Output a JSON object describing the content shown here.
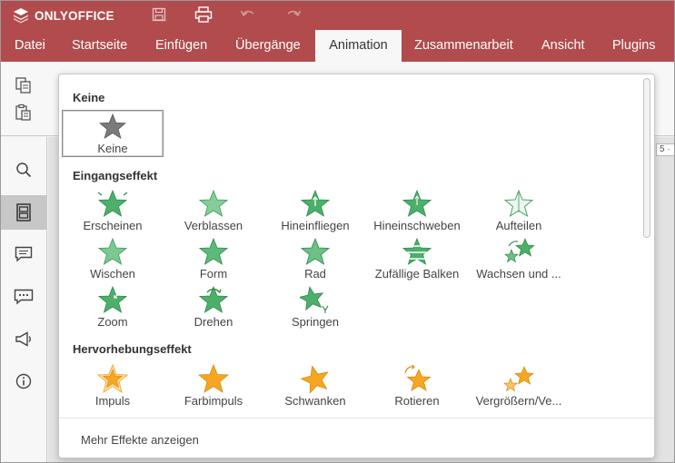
{
  "app": {
    "logo_text": "ONLYOFFICE"
  },
  "quick_access": [
    {
      "name": "save-icon"
    },
    {
      "name": "print-icon"
    },
    {
      "name": "undo-icon"
    },
    {
      "name": "redo-icon"
    }
  ],
  "tabs": [
    "Datei",
    "Startseite",
    "Einfügen",
    "Übergänge",
    "Animation",
    "Zusammenarbeit",
    "Ansicht",
    "Plugins"
  ],
  "active_tab": "Animation",
  "ruler_fragment": "5 ·",
  "panel": {
    "sections": {
      "none": "Keine",
      "entrance": "Eingangseffekt",
      "emphasis": "Hervorhebungseffekt"
    },
    "none_effects": [
      "Keine"
    ],
    "entrance_effects": [
      "Erscheinen",
      "Verblassen",
      "Hineinfliegen",
      "Hineinschweben",
      "Aufteilen",
      "Wischen",
      "Form",
      "Rad",
      "Zufällige Balken",
      "Wachsen und ...",
      "Zoom",
      "Drehen",
      "Springen"
    ],
    "emphasis_effects": [
      "Impuls",
      "Farbimpuls",
      "Schwanken",
      "Rotieren",
      "Vergrößern/Ve..."
    ],
    "more_effects": "Mehr Effekte anzeigen"
  },
  "colors": {
    "brand": "#b14b4d",
    "entrance_green": "#4caf6a",
    "emphasis_orange": "#f5a623",
    "none_gray": "#777777"
  }
}
